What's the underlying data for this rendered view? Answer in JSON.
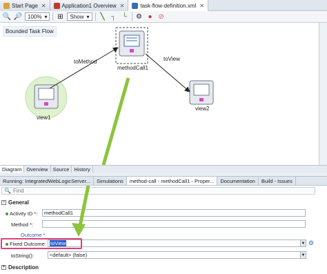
{
  "doc_tabs": [
    {
      "label": "Start Page",
      "color": "#d9a23c"
    },
    {
      "label": "Application1 Overview",
      "color": "#c0392b"
    },
    {
      "label": "task-flow-definition.xml",
      "color": "#3b6db3"
    }
  ],
  "toolbar": {
    "zoom": "100%",
    "show_label": "Show"
  },
  "canvas": {
    "title": "Bounded Task Flow",
    "nodes": {
      "view1": "view1",
      "methodCall1": "methodCall1",
      "view2": "view2"
    },
    "edges": {
      "toMethod": "toMethod",
      "toView": "toView"
    }
  },
  "diagram_tabs": [
    "Diagram",
    "Overview",
    "Source",
    "History"
  ],
  "panel_tabs": [
    "Running: IntegratedWebLogicServer...",
    "Simulations",
    "method-call - methodCall1 - Proper...",
    "Documentation",
    "Build - Issues"
  ],
  "inspector": {
    "find_placeholder": "Find",
    "general": "General",
    "activity_id_label": "Activity ID *:",
    "activity_id_value": "methodCall1",
    "method_label": "Method *:",
    "method_value": "",
    "outcome_label": "Outcome *",
    "fixed_outcome_label": "Fixed Outcome:",
    "fixed_outcome_value": "toView",
    "tostring_label": "toString():",
    "tostring_value": "<default> (false)",
    "description": "Description"
  },
  "colors": {
    "highlight": "#e0407a",
    "arrow": "#8cc43c",
    "selection": "#2b5fcf"
  }
}
